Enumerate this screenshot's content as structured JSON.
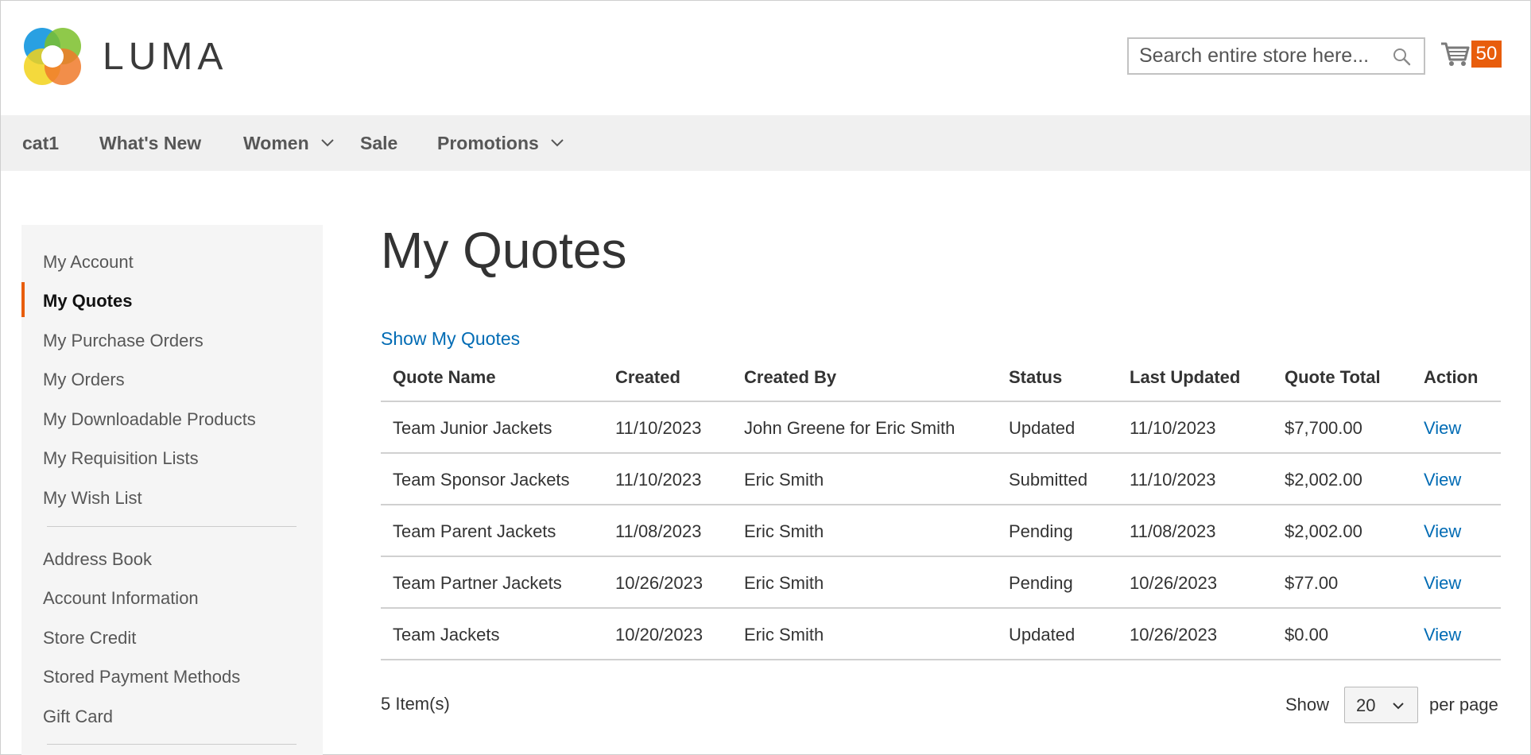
{
  "header": {
    "logo_text": "LUMA",
    "search_placeholder": "Search entire store here...",
    "cart_count": "50",
    "colors": {
      "accent": "#e85d0c",
      "link": "#006bb4"
    }
  },
  "nav": {
    "items": [
      {
        "label": "cat1",
        "has_dropdown": false
      },
      {
        "label": "What's New",
        "has_dropdown": false
      },
      {
        "label": "Women",
        "has_dropdown": true
      },
      {
        "label": "Sale",
        "has_dropdown": false
      },
      {
        "label": "Promotions",
        "has_dropdown": true
      }
    ]
  },
  "sidebar": {
    "items": [
      {
        "label": "My Account"
      },
      {
        "label": "My Quotes",
        "active": true
      },
      {
        "label": "My Purchase Orders"
      },
      {
        "label": "My Orders"
      },
      {
        "label": "My Downloadable Products"
      },
      {
        "label": "My Requisition Lists"
      },
      {
        "label": "My Wish List"
      },
      {
        "label": "Address Book"
      },
      {
        "label": "Account Information"
      },
      {
        "label": "Store Credit"
      },
      {
        "label": "Stored Payment Methods"
      },
      {
        "label": "Gift Card"
      }
    ]
  },
  "main": {
    "title": "My Quotes",
    "show_link": "Show My Quotes",
    "table": {
      "headers": [
        "Quote Name",
        "Created",
        "Created By",
        "Status",
        "Last Updated",
        "Quote Total",
        "Action"
      ],
      "rows": [
        [
          "Team Junior Jackets",
          "11/10/2023",
          "John Greene for Eric Smith",
          "Updated",
          "11/10/2023",
          "$7,700.00",
          "View"
        ],
        [
          "Team Sponsor Jackets",
          "11/10/2023",
          "Eric Smith",
          "Submitted",
          "11/10/2023",
          "$2,002.00",
          "View"
        ],
        [
          "Team Parent Jackets",
          "11/08/2023",
          "Eric Smith",
          "Pending",
          "11/08/2023",
          "$2,002.00",
          "View"
        ],
        [
          "Team Partner Jackets",
          "10/26/2023",
          "Eric Smith",
          "Pending",
          "10/26/2023",
          "$77.00",
          "View"
        ],
        [
          "Team Jackets",
          "10/20/2023",
          "Eric Smith",
          "Updated",
          "10/26/2023",
          "$0.00",
          "View"
        ]
      ]
    },
    "pager": {
      "items_count": "5 Item(s)",
      "show_label": "Show",
      "limit_value": "20",
      "per_page_label": "per page"
    }
  }
}
